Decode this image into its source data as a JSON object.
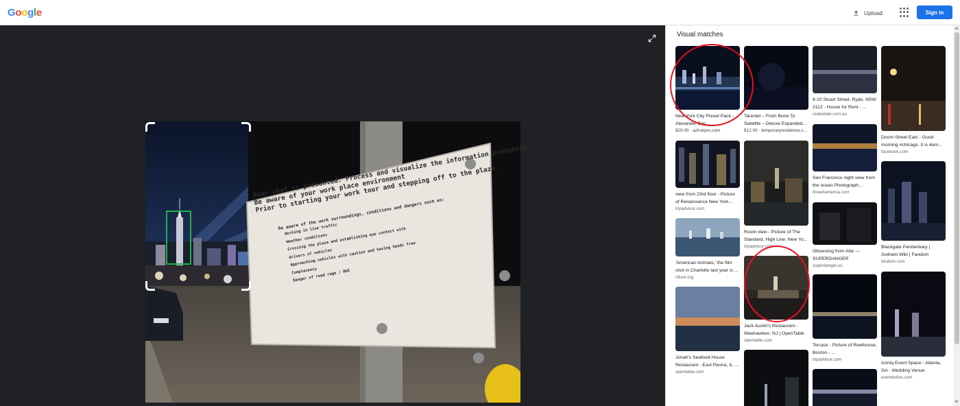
{
  "header": {
    "logo_letters": [
      {
        "ch": "G",
        "color": "#4285f4"
      },
      {
        "ch": "o",
        "color": "#ea4335"
      },
      {
        "ch": "o",
        "color": "#fbbc05"
      },
      {
        "ch": "g",
        "color": "#4285f4"
      },
      {
        "ch": "l",
        "color": "#34a853"
      },
      {
        "ch": "e",
        "color": "#ea4335"
      }
    ],
    "upload_label": "Upload",
    "upload_icon": "upload-icon",
    "apps_icon": "apps-grid-icon",
    "signin_label": "Sign in",
    "signin_color": "#1a73e8"
  },
  "viewer": {
    "expand_icon": "expand-icon",
    "sign": {
      "lines": [
        "Hear what is presented. Process and visualize the information presented.",
        "Be aware of your work place environment",
        "Prior to starting your work tour and stepping off to the plaza."
      ],
      "bullet_head": "Be aware of the work surroundings, conditions and dangers such as:",
      "sub_items": [
        "Working in live traffic",
        "Weather conditions",
        "Crossing the plaza and establishing eye contact with",
        "drivers of vehicles",
        "Approaching vehicles with caution and having hands free",
        "Complacency",
        "Danger of road rage / DWI"
      ]
    },
    "selection_box_color": "#1db34a"
  },
  "results": {
    "title": "Visual matches",
    "annotation_color": "#e8101c",
    "columns": [
      [
        {
          "caption": "New York City Preset Pack - Alexander Bau...",
          "price": "$29.00 · azhukpro.com",
          "source": ""
        },
        {
          "caption": "view from 23rd floor - Picture of Renaissance New York...",
          "price": "",
          "source": "tripadvisor.com"
        },
        {
          "caption": "'American Animals,' the film shot in Charlotte last year is ...",
          "price": "",
          "source": "clture.org"
        },
        {
          "caption": "Jonah's Seafood House Restaurant - East Peoria, IL | ...",
          "price": "",
          "source": "opentable.com"
        }
      ],
      [
        {
          "caption": "Tarentel – From Bone To Satellite – Deluxe Expanded...",
          "price": "$12.00 · temporaryresidence.c...",
          "source": ""
        },
        {
          "caption": "Room view - Picture of The Standard, High Line, New Yo...",
          "price": "",
          "source": "tripadvisor.com"
        },
        {
          "caption": "Jack Austin's Restaurant - Weehawken, NJ | OpenTable",
          "price": "",
          "source": "opentable.com"
        },
        {
          "caption": "",
          "price": "",
          "source": ""
        }
      ],
      [
        {
          "caption": "8-10 Stuart Street, Ryde, NSW 2112 - House for Rent - ...",
          "price": "",
          "source": "realestate.com.au"
        },
        {
          "caption": "San Francisco night view from the ocean Photograph...",
          "price": "",
          "source": "fineartamerica.com"
        },
        {
          "caption": "Observing from Afar — SUPERDANGER",
          "price": "",
          "source": "superdanger.us"
        },
        {
          "caption": "Terrace - Picture of Reelhouse, Boston - ...",
          "price": "",
          "source": "tripadvisor.com"
        },
        {
          "caption": "",
          "price": "",
          "source": ""
        }
      ],
      [
        {
          "caption": "Doom Street Eats - Good morning #chicago. It is 4am...",
          "price": "",
          "source": "facebook.com"
        },
        {
          "caption": "Blackgate Penitentiary | Gotham Wiki | Fandom",
          "price": "",
          "source": "fandom.com"
        },
        {
          "caption": "Iconiq Event Space - Atlanta, GA - Wedding Venue",
          "price": "",
          "source": "eventective.com"
        }
      ]
    ]
  }
}
